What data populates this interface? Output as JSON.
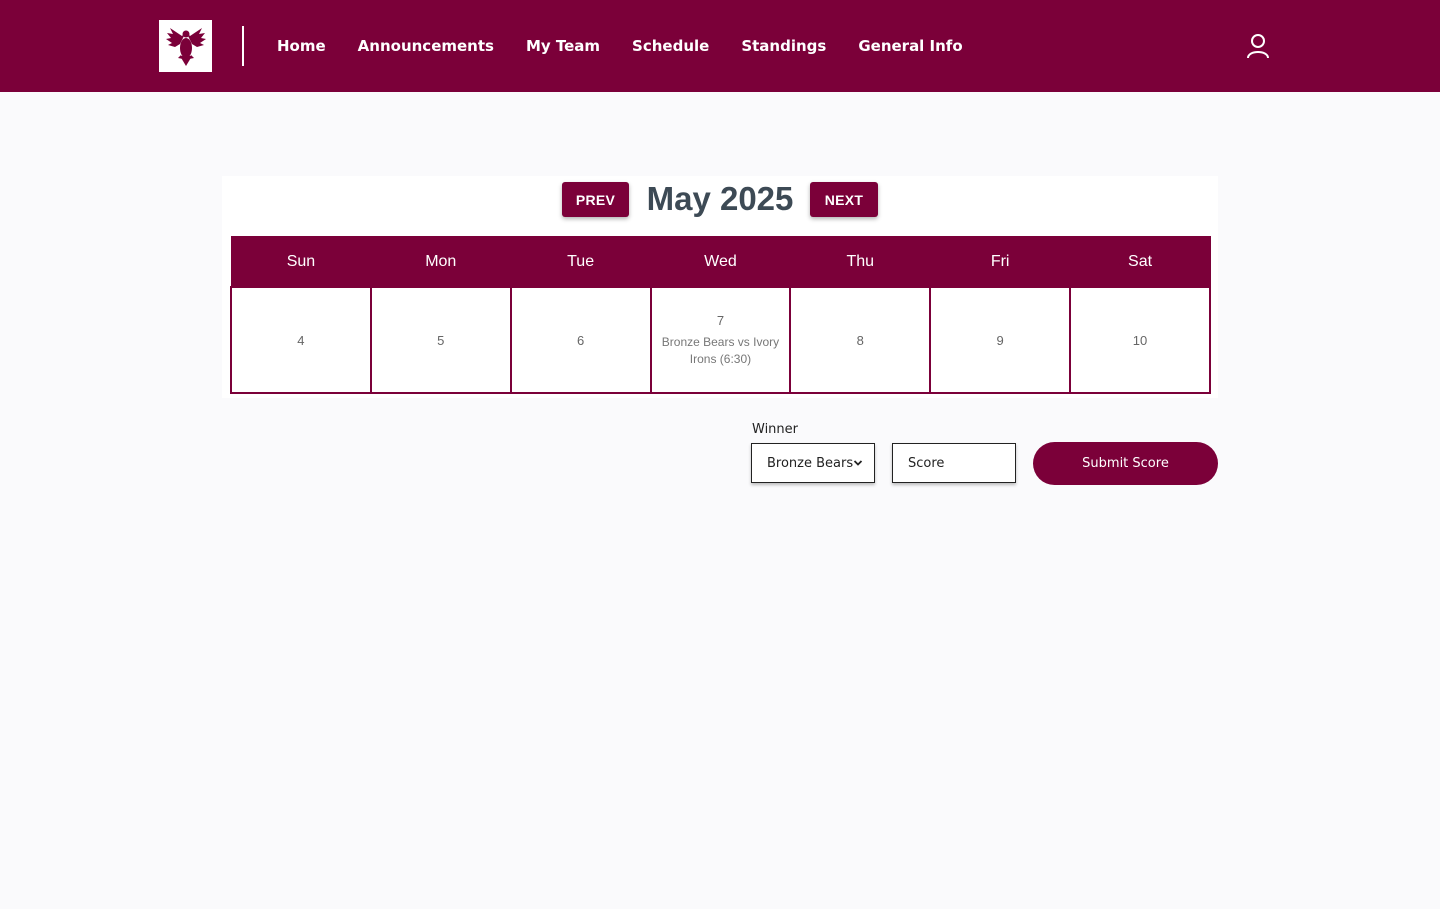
{
  "nav": {
    "logo": "eagle-crest-icon",
    "links": [
      "Home",
      "Announcements",
      "My Team",
      "Schedule",
      "Standings",
      "General Info"
    ],
    "user_icon": "user-icon"
  },
  "calendar": {
    "prev_label": "PREV",
    "next_label": "NEXT",
    "month_title": "May 2025",
    "weekdays": [
      "Sun",
      "Mon",
      "Tue",
      "Wed",
      "Thu",
      "Fri",
      "Sat"
    ],
    "days": [
      {
        "num": "4",
        "event": ""
      },
      {
        "num": "5",
        "event": ""
      },
      {
        "num": "6",
        "event": ""
      },
      {
        "num": "7",
        "event": "Bronze Bears vs Ivory Irons (6:30)"
      },
      {
        "num": "8",
        "event": ""
      },
      {
        "num": "9",
        "event": ""
      },
      {
        "num": "10",
        "event": ""
      }
    ]
  },
  "score_form": {
    "winner_label": "Winner",
    "winner_selected": "Bronze Bears",
    "score_placeholder": "Score",
    "score_value": "",
    "submit_label": "Submit Score"
  },
  "colors": {
    "brand": "#7b0039",
    "background": "#fafafc",
    "title_text": "#3d4a55"
  }
}
